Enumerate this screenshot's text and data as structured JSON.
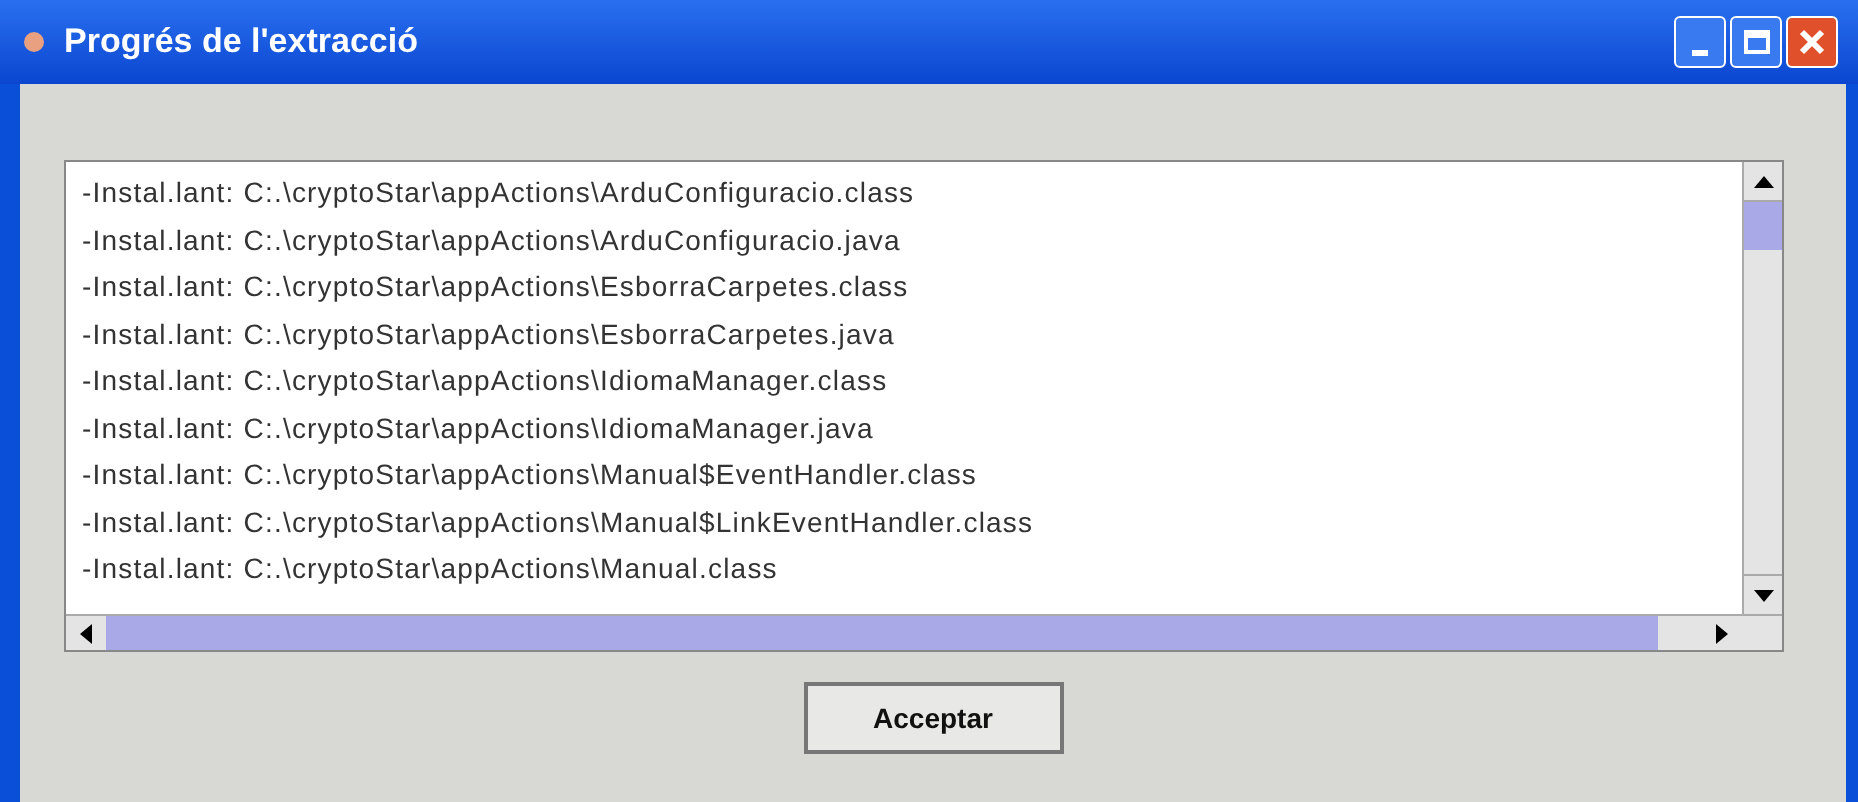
{
  "window": {
    "title": "Progrés de l'extracció"
  },
  "log_lines": [
    "-Instal.lant: C:.\\cryptoStar\\appActions\\ArduConfiguracio.class",
    "-Instal.lant: C:.\\cryptoStar\\appActions\\ArduConfiguracio.java",
    "-Instal.lant: C:.\\cryptoStar\\appActions\\EsborraCarpetes.class",
    "-Instal.lant: C:.\\cryptoStar\\appActions\\EsborraCarpetes.java",
    "-Instal.lant: C:.\\cryptoStar\\appActions\\IdiomaManager.class",
    "-Instal.lant: C:.\\cryptoStar\\appActions\\IdiomaManager.java",
    "-Instal.lant: C:.\\cryptoStar\\appActions\\Manual$EventHandler.class",
    "-Instal.lant: C:.\\cryptoStar\\appActions\\Manual$LinkEventHandler.class",
    "-Instal.lant: C:.\\cryptoStar\\appActions\\Manual.class"
  ],
  "buttons": [
    "Acceptar"
  ]
}
